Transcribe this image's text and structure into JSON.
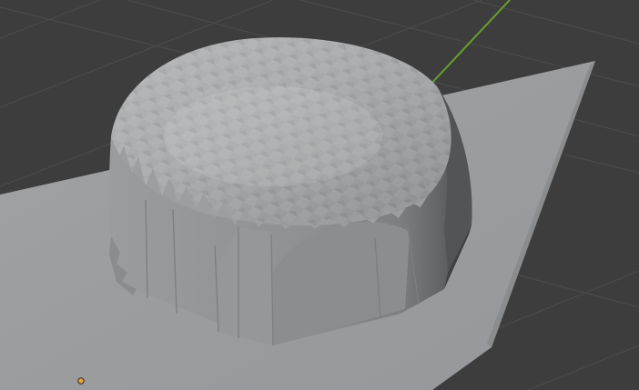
{
  "viewport": {
    "background_color": "#3d3d3d",
    "grid_color": "#4a4a4a",
    "y_axis_color": "#6aa02c"
  },
  "scene": {
    "plane_color": "#9c9e9f",
    "dome_top_color": "#a6a8a9",
    "dome_side_color": "#8f9192",
    "dome_shadow_color": "#525253",
    "origin_marker_color": "#e8a33a"
  }
}
